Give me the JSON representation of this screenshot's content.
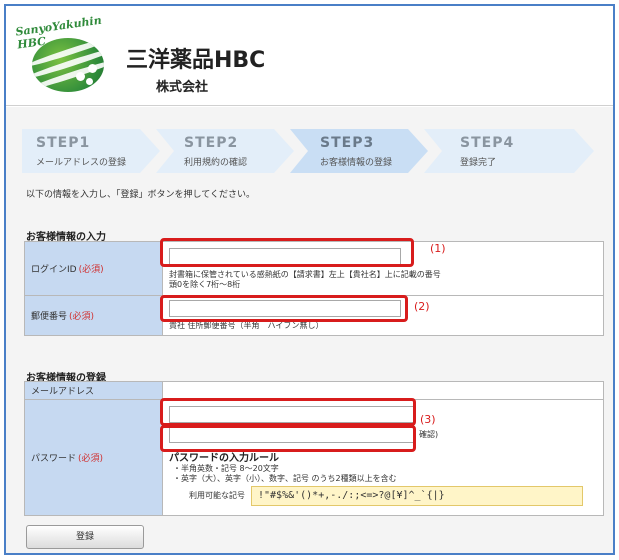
{
  "brand": {
    "logo_text": "SanyoYakuhin HBC",
    "company_name": "三洋薬品HBC",
    "company_sub": "株式会社"
  },
  "steps": [
    {
      "title": "STEP1",
      "subtitle": "メールアドレスの登録",
      "active": false
    },
    {
      "title": "STEP2",
      "subtitle": "利用規約の確認",
      "active": false
    },
    {
      "title": "STEP3",
      "subtitle": "お客様情報の登録",
      "active": true
    },
    {
      "title": "STEP4",
      "subtitle": "登録完了",
      "active": false
    }
  ],
  "intro": "以下の情報を入力し、「登録」ボタンを押してください。",
  "section1": {
    "title": "お客様情報の入力",
    "login_label": "ログインID",
    "login_required": "(必須)",
    "login_value": "",
    "login_hint1": "封書箱に保管されている感熱紙の【請求書】左上【貴社名】上に記載の番号",
    "login_hint2": "頭0を除く7桁〜8桁",
    "postal_label": "郵便番号",
    "postal_required": "(必須)",
    "postal_value": "",
    "postal_hint": "貴社 住所郵便番号（半角　ハイフン無し）"
  },
  "section2": {
    "title": "お客様情報の登録",
    "email_label": "メールアドレス",
    "email_value": "",
    "password_label": "パスワード",
    "password_required": "(必須)",
    "password_value": "",
    "password_confirm_value": "",
    "confirm_suffix": "確認)",
    "rules_title": "パスワードの入力ルール",
    "rules": [
      "・半角英数・記号 8〜20文字",
      "・英字（大）、英字（小）、数字、記号 のうち2種類以上を含む"
    ],
    "symbols_label": "利用可能な記号",
    "symbols": "!\"#$%&'()*+,-./:;<=>?@[¥]^_`{|}"
  },
  "annotations": {
    "a1": "(1)",
    "a2": "(2)",
    "a3": "(3)"
  },
  "submit_label": "登録",
  "colors": {
    "frame_border": "#4a7fc7",
    "label_bg": "#c6d9f1",
    "step_bg": "#e3eef9",
    "step_active_bg": "#c9def4",
    "highlight_red": "#d81c1c",
    "required_red": "#d03030",
    "symbols_bg": "#fff5c8"
  }
}
